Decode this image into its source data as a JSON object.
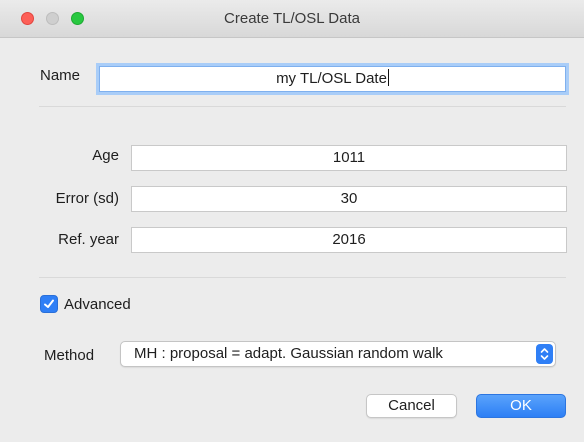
{
  "window": {
    "title": "Create TL/OSL Data",
    "controls": {
      "close": "close-button",
      "minimize": "minimize-button",
      "zoom": "zoom-button"
    }
  },
  "form": {
    "name_label": "Name",
    "name_value": "my TL/OSL Date",
    "age_label": "Age",
    "age_value": "1011",
    "error_label": "Error (sd)",
    "error_value": "30",
    "refyear_label": "Ref. year",
    "refyear_value": "2016",
    "advanced_label": "Advanced",
    "advanced_checked": true,
    "method_label": "Method",
    "method_value": "MH : proposal = adapt. Gaussian random walk"
  },
  "buttons": {
    "cancel": "Cancel",
    "ok": "OK"
  },
  "colors": {
    "accent": "#2f7ff6",
    "focus_ring": "#a9cdf8",
    "close": "#fd5f57",
    "zoom": "#28c840",
    "window_bg": "#ececec"
  },
  "icons": {
    "checkbox": "checkmark-icon",
    "select_arrows": "chevron-up-down-icon"
  }
}
